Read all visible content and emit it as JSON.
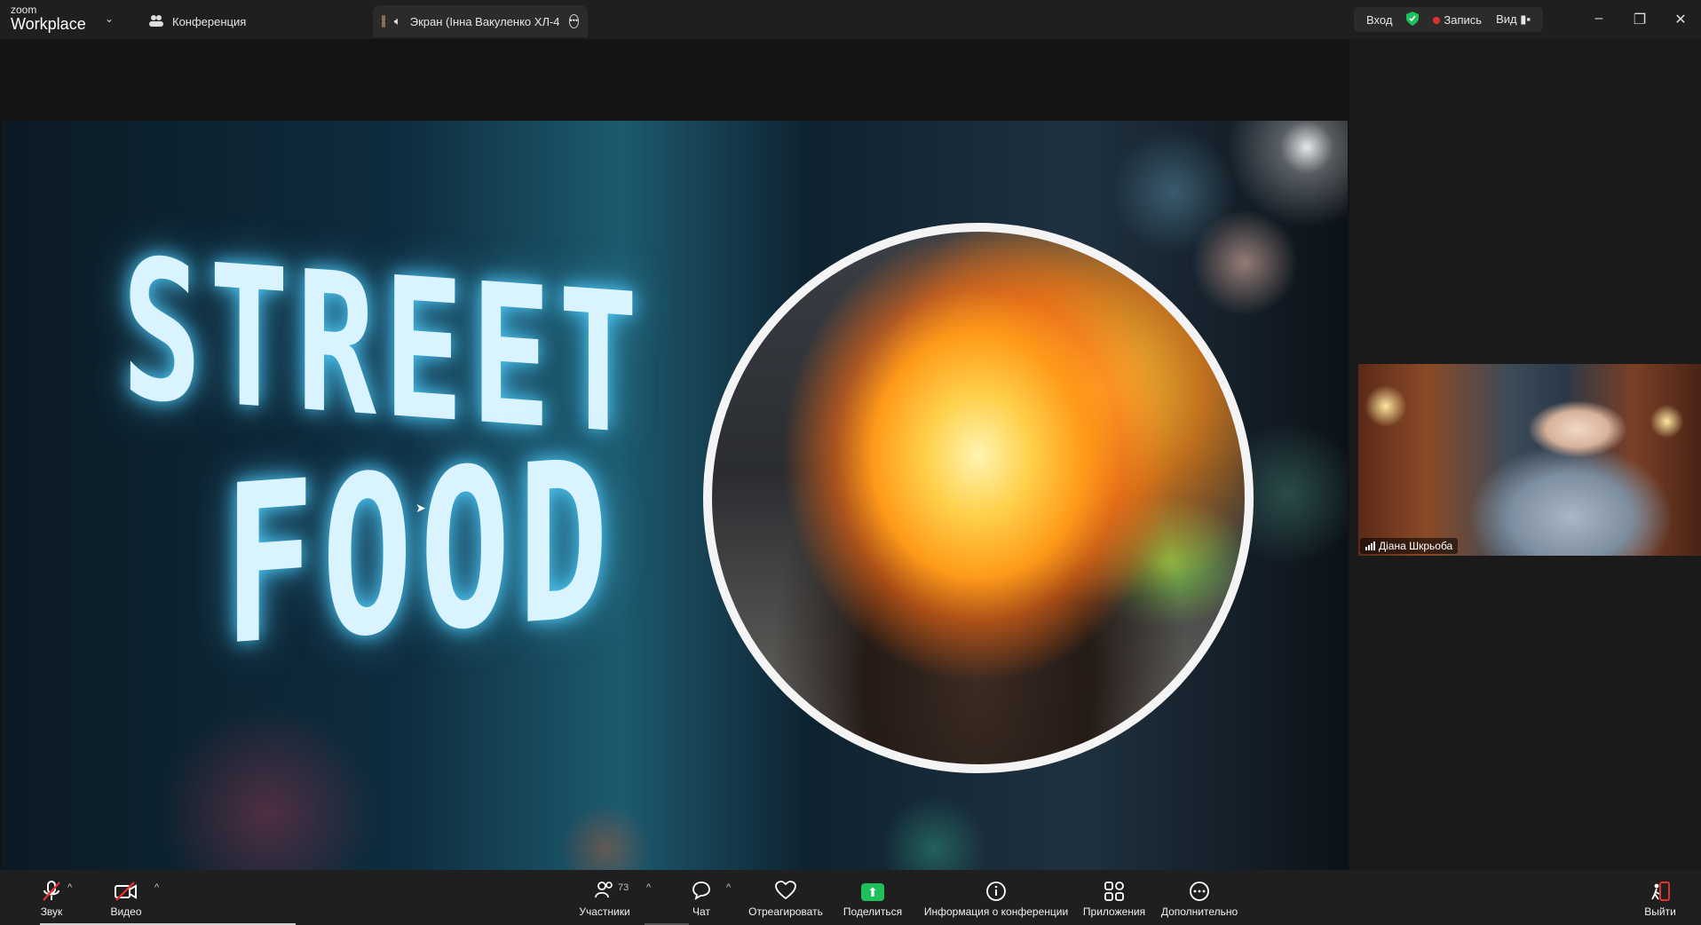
{
  "app": {
    "brand_top": "zoom",
    "brand_bottom": "Workplace"
  },
  "tabs": [
    {
      "label": "Конференция"
    },
    {
      "label": "Экран (Інна Вакуленко ХЛ-4"
    }
  ],
  "header_right": {
    "signin": "Вход",
    "record": "Запись",
    "view": "Вид"
  },
  "shared_screen": {
    "word1": "STREET",
    "word2": "FOOD"
  },
  "participant": {
    "name": "Діана Шкрьоба"
  },
  "toolbar": {
    "audio": "Звук",
    "video": "Видео",
    "participants": "Участники",
    "participants_count": "73",
    "chat": "Чат",
    "react": "Отреагировать",
    "share": "Поделиться",
    "info": "Информация о конференции",
    "apps": "Приложения",
    "more": "Дополнительно",
    "leave": "Выйти"
  },
  "colors": {
    "share_green": "#1fbf5c",
    "record_red": "#e0312f",
    "shield_green": "#1fbf5c"
  }
}
